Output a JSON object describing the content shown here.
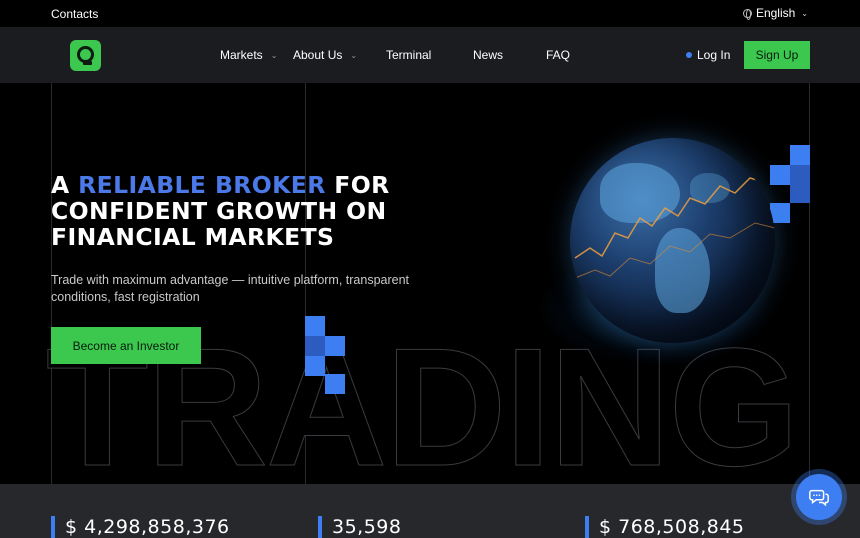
{
  "topbar": {
    "contacts": "Contacts",
    "language": "English",
    "globe_icon": "globe-icon",
    "chevron_icon": "chevron-down-icon"
  },
  "nav": {
    "logo_icon": "brand-logo-icon",
    "items": [
      {
        "label": "Markets",
        "has_dropdown": true
      },
      {
        "label": "About Us",
        "has_dropdown": true
      },
      {
        "label": "Terminal",
        "has_dropdown": false
      },
      {
        "label": "News",
        "has_dropdown": false
      },
      {
        "label": "FAQ",
        "has_dropdown": false
      }
    ],
    "login": "Log In",
    "signup": "Sign Up"
  },
  "hero": {
    "headline_prefix": "A ",
    "headline_accent": "RELIABLE BROKER",
    "headline_rest1": " FOR",
    "headline_line2": "CONFIDENT GROWTH ON",
    "headline_line3": "FINANCIAL MARKETS",
    "subtitle": "Trade with maximum advantage — intuitive platform, transparent conditions, fast registration",
    "cta": "Become an Investor",
    "background_word": "TRADING",
    "globe_image": "globe-with-trading-chart-image"
  },
  "stats": [
    {
      "value": "$ 4,298,858,376"
    },
    {
      "value": "35,598"
    },
    {
      "value": "$ 768,508,845"
    }
  ],
  "chat": {
    "icon": "chat-bubbles-icon"
  },
  "colors": {
    "accent_blue": "#3d7ff2",
    "headline_blue": "#4b7ae8",
    "brand_green": "#3cc74f",
    "nav_bg": "#1b1c1f",
    "stats_bg": "#27282c"
  }
}
